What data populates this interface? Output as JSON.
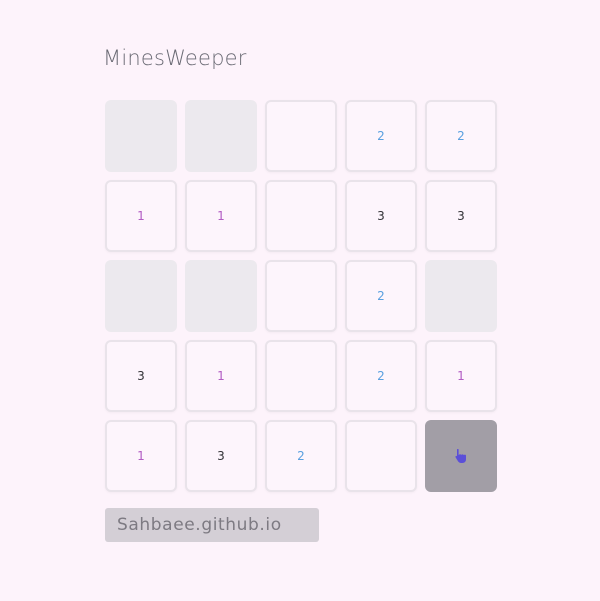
{
  "app": {
    "title": "MinesWeeper"
  },
  "board": {
    "rows": [
      [
        {
          "state": "hidden",
          "value": ""
        },
        {
          "state": "hidden",
          "value": ""
        },
        {
          "state": "revealed",
          "value": ""
        },
        {
          "state": "revealed",
          "value": "2"
        },
        {
          "state": "revealed",
          "value": "2"
        }
      ],
      [
        {
          "state": "revealed",
          "value": "1"
        },
        {
          "state": "revealed",
          "value": "1"
        },
        {
          "state": "revealed",
          "value": ""
        },
        {
          "state": "revealed",
          "value": "3"
        },
        {
          "state": "revealed",
          "value": "3"
        }
      ],
      [
        {
          "state": "hidden",
          "value": ""
        },
        {
          "state": "hidden",
          "value": ""
        },
        {
          "state": "revealed",
          "value": ""
        },
        {
          "state": "revealed",
          "value": "2"
        },
        {
          "state": "hidden",
          "value": ""
        }
      ],
      [
        {
          "state": "revealed",
          "value": "3"
        },
        {
          "state": "revealed",
          "value": "1"
        },
        {
          "state": "revealed",
          "value": ""
        },
        {
          "state": "revealed",
          "value": "2"
        },
        {
          "state": "revealed",
          "value": "1"
        }
      ],
      [
        {
          "state": "revealed",
          "value": "1"
        },
        {
          "state": "revealed",
          "value": "3"
        },
        {
          "state": "revealed",
          "value": "2"
        },
        {
          "state": "revealed",
          "value": ""
        },
        {
          "state": "active",
          "value": "",
          "icon": "hand-pointer-icon"
        }
      ]
    ]
  },
  "footer": {
    "link_label": "Sahbaee.github.io"
  },
  "colors": {
    "background": "#fdf3fb",
    "hidden_cell": "#ece9ee",
    "active_cell": "#a29ea6",
    "number_1": "#b25cc4",
    "number_2": "#5aa0e0",
    "number_3": "#333338"
  }
}
